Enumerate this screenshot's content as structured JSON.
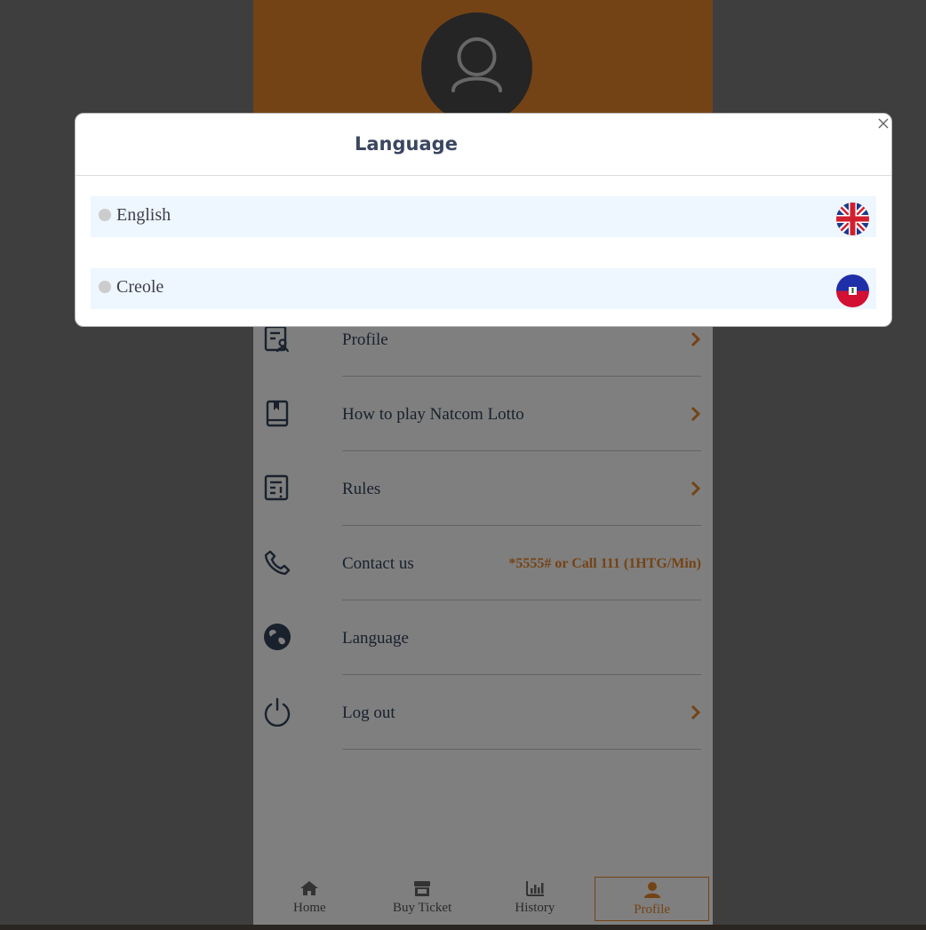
{
  "menu": {
    "items": [
      {
        "label": "Profile"
      },
      {
        "label": "How to play Natcom Lotto"
      },
      {
        "label": "Rules"
      },
      {
        "label": "Contact us",
        "value": "*5555# or Call 111 (1HTG/Min)"
      },
      {
        "label": "Language"
      },
      {
        "label": "Log out"
      }
    ]
  },
  "nav": {
    "items": [
      {
        "label": "Home",
        "icon": "home-icon"
      },
      {
        "label": "Buy Ticket",
        "icon": "store-icon"
      },
      {
        "label": "History",
        "icon": "bar-chart-icon"
      },
      {
        "label": "Profile",
        "icon": "user-icon",
        "active": true
      }
    ]
  },
  "modal": {
    "title": "Language",
    "options": [
      {
        "label": "English",
        "flag": "uk-flag-icon",
        "selected": false
      },
      {
        "label": "Creole",
        "flag": "haiti-flag-icon",
        "selected": false
      }
    ]
  },
  "colors": {
    "accent": "#e8862a",
    "text_primary": "#33425b",
    "option_bg": "#eef6ff"
  }
}
